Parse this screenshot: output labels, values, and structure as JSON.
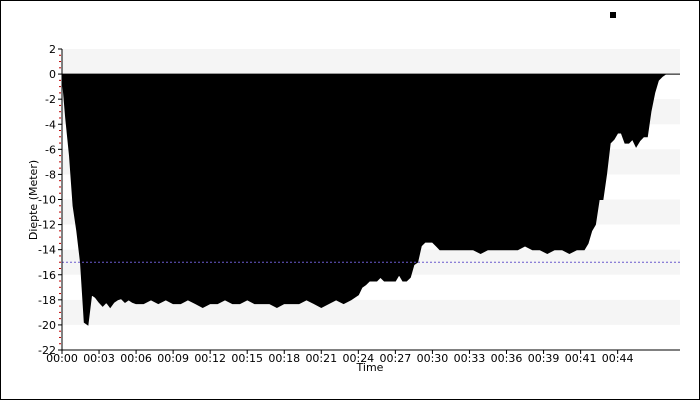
{
  "chart_data": {
    "type": "area",
    "title": "",
    "xlabel": "Time",
    "ylabel": "Diepte (Meter)",
    "ylim": [
      -22,
      2
    ],
    "xlim_minutes": [
      0,
      45.5
    ],
    "y_ticks": [
      2,
      0,
      -2,
      -4,
      -6,
      -8,
      -10,
      -12,
      -14,
      -16,
      -18,
      -20,
      -22
    ],
    "x_tick_labels": [
      "00:00",
      "00:03",
      "00:06",
      "00:09",
      "00:12",
      "00:15",
      "00:18",
      "00:21",
      "00:24",
      "00:27",
      "00:30",
      "00:33",
      "00:36",
      "00:39",
      "00:41",
      "00:44"
    ],
    "x_tick_minutes": [
      0,
      2.727,
      5.455,
      8.182,
      10.909,
      13.636,
      16.364,
      19.091,
      21.818,
      24.545,
      27.273,
      30,
      32.727,
      35.455,
      38.182,
      40.909
    ],
    "reference_line": {
      "value": -15,
      "color": "#6a5acd",
      "style": "dotted"
    },
    "band_color": "#f5f5f5",
    "fill_color": "#000000",
    "legend_marker": "square",
    "series": [
      {
        "x": [
          0,
          0.27,
          0.55,
          0.82,
          1.09,
          1.36,
          1.64,
          1.91,
          2.18,
          2.45,
          2.73,
          3.0,
          3.27,
          3.55,
          3.82,
          4.09,
          4.36,
          4.64,
          4.91,
          5.18,
          5.45,
          6.0,
          6.55,
          7.09,
          7.64,
          8.18,
          8.73,
          9.27,
          9.82,
          10.36,
          10.91,
          11.45,
          12.0,
          12.55,
          13.09,
          13.64,
          14.18,
          14.73,
          15.27,
          15.82,
          16.36,
          16.91,
          17.45,
          18.0,
          18.55,
          19.09,
          19.64,
          20.18,
          20.73,
          21.27,
          21.82,
          22.09,
          22.36,
          22.64,
          22.91,
          23.18,
          23.45,
          23.73,
          24.0,
          24.27,
          24.55,
          24.82,
          25.09,
          25.36,
          25.64,
          25.91,
          26.18,
          26.45,
          26.73,
          27.0,
          27.27,
          27.55,
          27.82,
          28.09,
          28.36,
          28.64,
          29.18,
          29.73,
          30.27,
          30.82,
          31.36,
          31.91,
          32.45,
          33.0,
          33.55,
          34.09,
          34.64,
          35.18,
          35.73,
          36.27,
          36.82,
          37.36,
          37.91,
          38.18,
          38.45,
          38.73,
          39.0,
          39.27,
          39.55,
          39.82,
          40.09,
          40.36,
          40.64,
          40.91,
          41.18,
          41.45,
          41.73,
          42.0,
          42.27,
          42.55,
          42.82,
          43.09,
          43.36,
          43.64,
          43.91,
          44.18,
          44.45,
          44.73,
          45.0,
          45.27,
          45.5
        ],
        "values": [
          0,
          -3.5,
          -6.5,
          -10.5,
          -12.5,
          -15.0,
          -19.8,
          -20.0,
          -17.6,
          -17.8,
          -18.2,
          -18.5,
          -18.2,
          -18.6,
          -18.2,
          -18.0,
          -17.9,
          -18.2,
          -18.0,
          -18.2,
          -18.3,
          -18.3,
          -18.0,
          -18.3,
          -18.0,
          -18.3,
          -18.3,
          -18.0,
          -18.3,
          -18.6,
          -18.3,
          -18.3,
          -18.0,
          -18.3,
          -18.3,
          -18.0,
          -18.3,
          -18.3,
          -18.3,
          -18.6,
          -18.3,
          -18.3,
          -18.3,
          -18.0,
          -18.3,
          -18.6,
          -18.3,
          -18.0,
          -18.3,
          -18.0,
          -17.6,
          -17.0,
          -16.8,
          -16.5,
          -16.5,
          -16.5,
          -16.2,
          -16.5,
          -16.5,
          -16.5,
          -16.5,
          -16.0,
          -16.5,
          -16.5,
          -16.2,
          -15.2,
          -15.0,
          -13.7,
          -13.4,
          -13.4,
          -13.4,
          -13.7,
          -14.0,
          -14.0,
          -14.0,
          -14.0,
          -14.0,
          -14.0,
          -14.0,
          -14.3,
          -14.0,
          -14.0,
          -14.0,
          -14.0,
          -14.0,
          -13.7,
          -14.0,
          -14.0,
          -14.3,
          -14.0,
          -14.0,
          -14.3,
          -14.0,
          -14.0,
          -14.0,
          -13.5,
          -12.5,
          -12.0,
          -10.0,
          -10.0,
          -8.0,
          -5.5,
          -5.2,
          -4.7,
          -4.7,
          -5.5,
          -5.5,
          -5.2,
          -5.8,
          -5.3,
          -5.0,
          -5.0,
          -3.0,
          -1.5,
          -0.5,
          -0.2,
          0,
          0,
          0,
          0,
          0
        ]
      }
    ]
  }
}
